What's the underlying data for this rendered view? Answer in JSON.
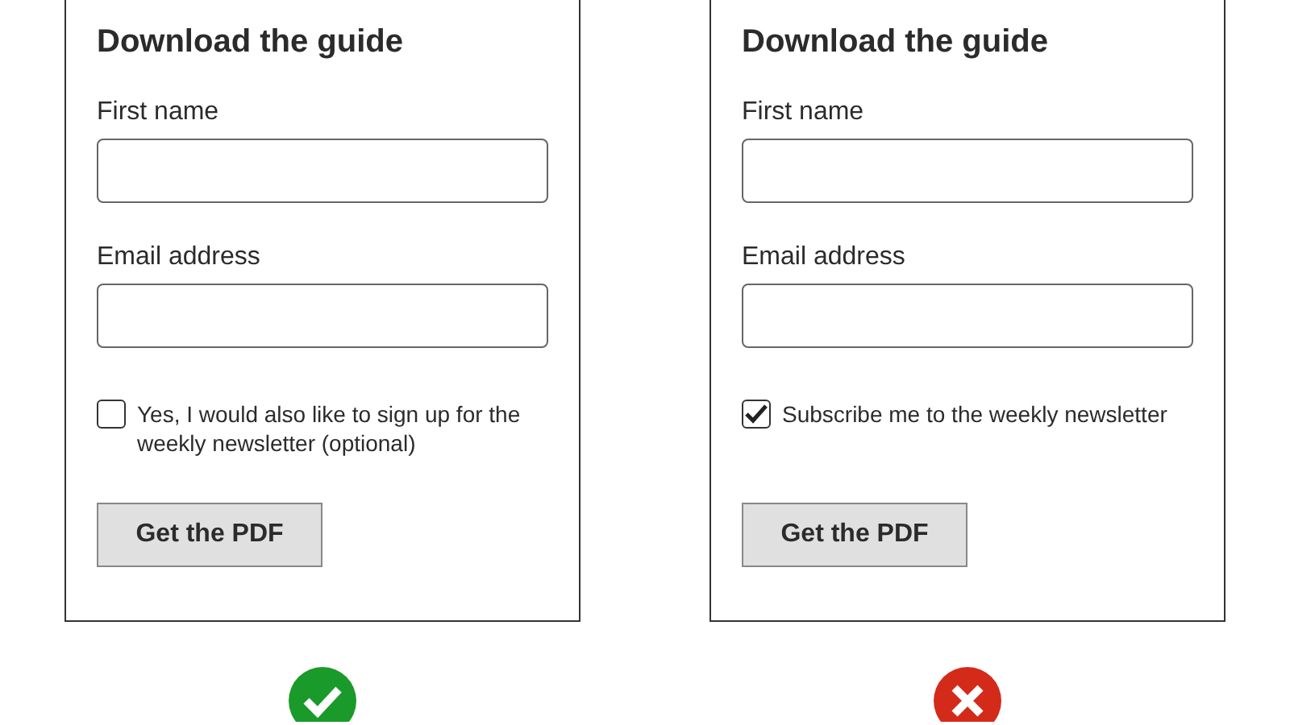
{
  "forms": [
    {
      "title": "Download the guide",
      "fields": [
        {
          "label": "First name"
        },
        {
          "label": "Email address"
        }
      ],
      "checkbox": {
        "label": "Yes, I would also like to sign up for the weekly newsletter (optional)",
        "checked": false
      },
      "button": "Get the PDF",
      "verdict": {
        "kind": "correct"
      }
    },
    {
      "title": "Download the guide",
      "fields": [
        {
          "label": "First name"
        },
        {
          "label": "Email address"
        }
      ],
      "checkbox": {
        "label": "Subscribe me to the weekly newsletter",
        "checked": true
      },
      "button": "Get the PDF",
      "verdict": {
        "kind": "incorrect"
      }
    }
  ]
}
